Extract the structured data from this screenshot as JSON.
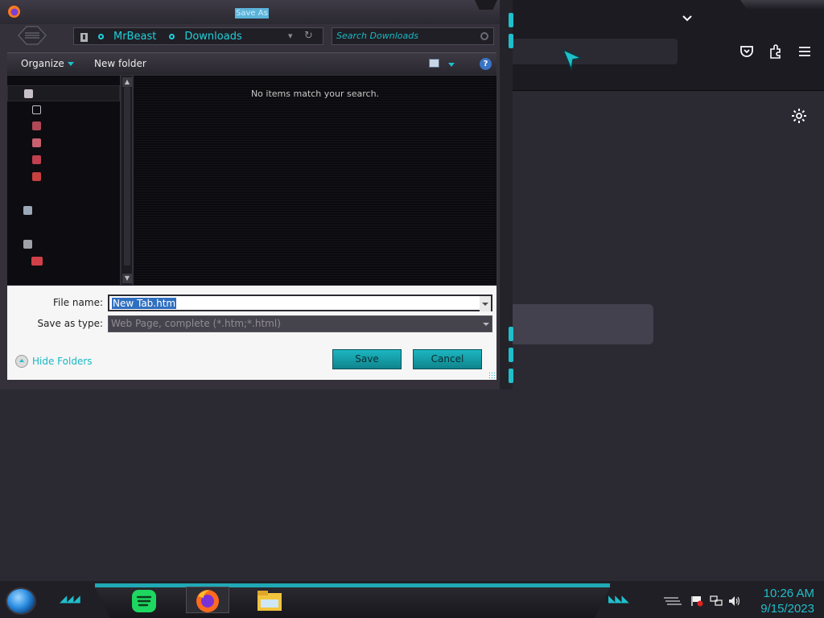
{
  "dialog": {
    "title": "Save As",
    "breadcrumb": [
      "MrBeast",
      "Downloads"
    ],
    "search_placeholder": "Search Downloads",
    "toolbar": {
      "organize_label": "Organize",
      "new_folder_label": "New folder",
      "help_glyph": "?"
    },
    "navpane": {
      "items": [
        {
          "icon": "star-icon",
          "color": "#c8c0c8"
        },
        {
          "icon": "folder-icon",
          "color": "#c0c0c8"
        },
        {
          "icon": "folder-icon",
          "color": "#b04858"
        },
        {
          "icon": "folder-icon",
          "color": "#c86070"
        },
        {
          "icon": "folder-icon",
          "color": "#c04050"
        },
        {
          "icon": "folder-icon",
          "color": "#c84040"
        },
        {
          "icon": "homegroup-icon",
          "color": "#9ca8b8"
        },
        {
          "icon": "computer-icon",
          "color": "#a0a0a8"
        },
        {
          "icon": "drive-icon",
          "color": "#d04048"
        }
      ]
    },
    "empty_message": "No items match your search.",
    "file_name_label": "File name:",
    "file_name_value": "New Tab.htm",
    "save_type_label": "Save as type:",
    "save_type_value": "Web Page, complete (*.htm;*.html)",
    "hide_folders_label": "Hide Folders",
    "save_button": "Save",
    "cancel_button": "Cancel"
  },
  "browser": {
    "icons": [
      "chevron-down-icon",
      "pocket-icon",
      "extensions-icon",
      "menu-icon",
      "gear-icon"
    ]
  },
  "taskbar": {
    "apps": [
      "spotify-icon",
      "firefox-icon",
      "file-explorer-icon"
    ],
    "active_app": "firefox-icon",
    "tray": [
      "action-center-flag-icon",
      "network-icon",
      "volume-icon"
    ],
    "time": "10:26 AM",
    "date": "9/15/2023"
  },
  "colors": {
    "accent": "#1fbfcb",
    "dialog_bg": "#34313b",
    "browser_bg": "#2b2a33"
  }
}
